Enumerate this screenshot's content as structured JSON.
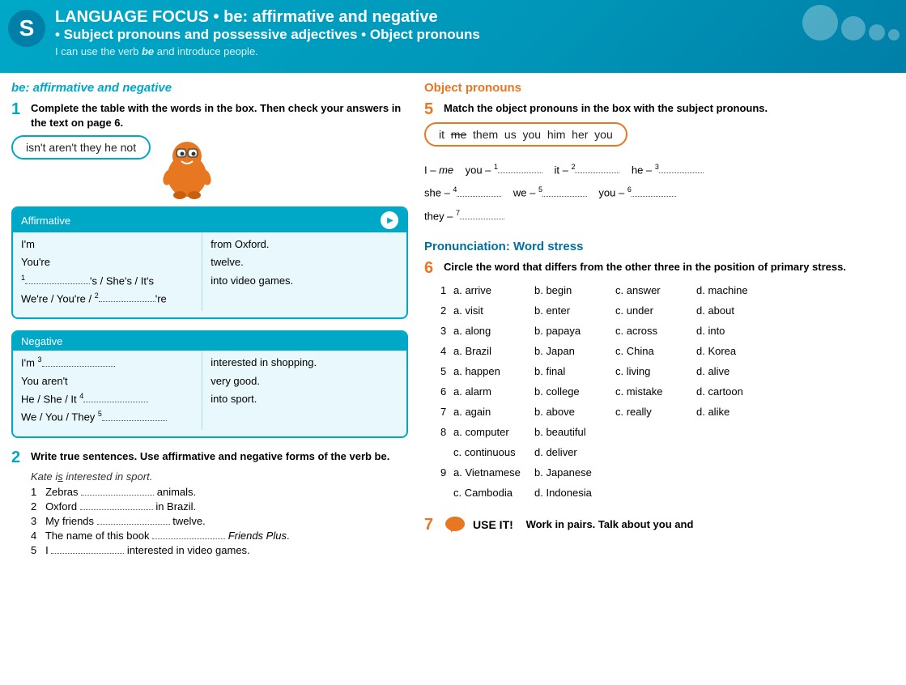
{
  "header": {
    "badge": "S",
    "title_line1": "LANGUAGE FOCUS • be: affirmative and negative",
    "title_line2": "• Subject pronouns and possessive adjectives • Object pronouns",
    "subtitle": "I can use the verb be and introduce people."
  },
  "left_section_title": "be: affirmative and negative",
  "ex1": {
    "num": "1",
    "instruction": "Complete the table with the words in the box. Then check your answers in the text on page 6.",
    "box_words": "isn't   aren't   they   he   not",
    "affirmative_header": "Affirmative",
    "affirmative_left": [
      "I'm",
      "You're",
      "¹............................'s / She's / It's",
      "We're / You're / ².............................'re"
    ],
    "affirmative_right": [
      "from Oxford.",
      "twelve.",
      "into video games.",
      ""
    ],
    "negative_header": "Negative",
    "negative_left": [
      "I'm ³.............................",
      "You aren't",
      "He / She / It ⁴.............................",
      "We / You / They ⁵............................."
    ],
    "negative_right": [
      "interested in shopping.",
      "very good.",
      "into sport.",
      ""
    ]
  },
  "ex2": {
    "num": "2",
    "instruction": "Write true sentences. Use affirmative and negative forms of the verb be.",
    "example": "Kate is interested in sport.",
    "items": [
      "Zebras ............................  animals.",
      "Oxford ............................  in Brazil.",
      "My friends ............................  twelve.",
      "The name of this book ............................  Friends Plus.",
      "I ............................  interested in video games."
    ]
  },
  "right_section_title": "Object pronouns",
  "ex5": {
    "num": "5",
    "instruction": "Match the object pronouns in the box with the subject pronouns.",
    "box_words": [
      "it",
      "me",
      "them",
      "us",
      "you",
      "him",
      "her",
      "you"
    ],
    "me_strikethrough": true,
    "match_lines": [
      "I – me   you – ¹..............   it – ²..............   he – ³..............",
      "she – ⁴..............   we – ⁵..............   you – ⁶..............",
      "they – ⁷.............."
    ]
  },
  "pron_section_title": "Pronunciation: Word stress",
  "ex6": {
    "num": "6",
    "instruction": "Circle the word that differs from the other three in the position of primary stress.",
    "rows": [
      {
        "num": "1",
        "a": "a. arrive",
        "b": "b. begin",
        "c": "c. answer",
        "d": "d. machine"
      },
      {
        "num": "2",
        "a": "a. visit",
        "b": "b. enter",
        "c": "c. under",
        "d": "d. about"
      },
      {
        "num": "3",
        "a": "a. along",
        "b": "b. papaya",
        "c": "c. across",
        "d": "d. into"
      },
      {
        "num": "4",
        "a": "a. Brazil",
        "b": "b. Japan",
        "c": "c. China",
        "d": "d. Korea"
      },
      {
        "num": "5",
        "a": "a. happen",
        "b": "b. final",
        "c": "c. living",
        "d": "d. alive"
      },
      {
        "num": "6",
        "a": "a. alarm",
        "b": "b. college",
        "c": "c. mistake",
        "d": "d. cartoon"
      },
      {
        "num": "7",
        "a": "a. again",
        "b": "b. above",
        "c": "c. really",
        "d": "d. alike"
      },
      {
        "num": "8a",
        "a": "a. computer",
        "b": "b. beautiful",
        "c": null,
        "d": null
      },
      {
        "num": "8c",
        "a": "c. continuous",
        "b": "d. deliver",
        "c": null,
        "d": null
      },
      {
        "num": "9a",
        "a": "a. Vietnamese",
        "b": "b. Japanese",
        "c": null,
        "d": null
      },
      {
        "num": "9c",
        "a": "c. Cambodia",
        "b": "d. Indonesia",
        "c": null,
        "d": null
      }
    ]
  },
  "ex7": {
    "num": "7",
    "instruction": "USE IT!  Work in pairs. Talk about you and"
  }
}
